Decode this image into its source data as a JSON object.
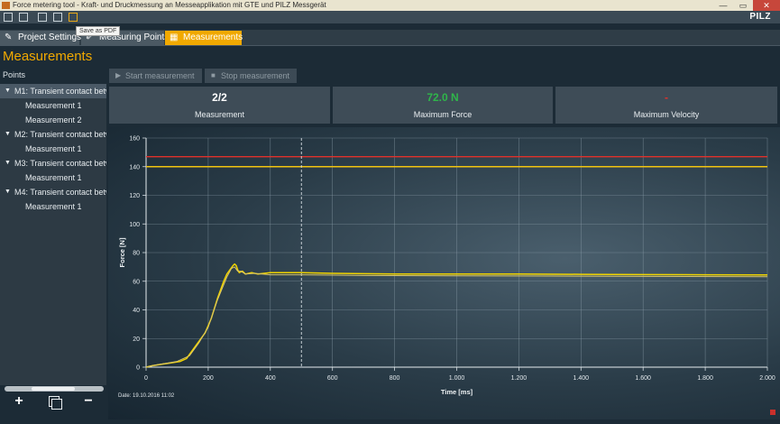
{
  "window": {
    "title": "Force metering tool - Kraft- und Druckmessung an Messeapplikation mit GTE und PILZ Messgerät",
    "brand": "PILZ",
    "minimize": "—",
    "maximize": "▭",
    "close": "✕"
  },
  "toolbar": {
    "tooltip": "Save as PDF"
  },
  "tabs": [
    {
      "label": "Project Settings",
      "icon": "✎"
    },
    {
      "label": "Measuring Points",
      "icon": "✐"
    },
    {
      "label": "Measurements",
      "icon": "▦"
    }
  ],
  "page": {
    "title": "Measurements",
    "points_label": "Points"
  },
  "tree": [
    {
      "label": "M1: Transient contact betw",
      "children": [
        "Measurement 1",
        "Measurement 2"
      ]
    },
    {
      "label": "M2: Transient contact betw",
      "children": [
        "Measurement 1"
      ]
    },
    {
      "label": "M3: Transient contact betw",
      "children": [
        "Measurement 1"
      ]
    },
    {
      "label": "M4: Transient contact betw",
      "children": [
        "Measurement 1"
      ]
    }
  ],
  "tree_buttons": {
    "add": "+",
    "remove": "−"
  },
  "controls": {
    "start": "Start measurement",
    "stop": "Stop measurement"
  },
  "cards": [
    {
      "value": "2/2",
      "label": "Measurement",
      "color": "#ffffff"
    },
    {
      "value": "72.0 N",
      "label": "Maximum Force",
      "color": "#2fb54a"
    },
    {
      "value": "-",
      "label": "Maximum Velocity",
      "color": "#e0312b"
    }
  ],
  "chart_footer": {
    "date": "Date: 19.10.2016 11:02"
  },
  "chart_data": {
    "type": "line",
    "xlabel": "Time [ms]",
    "ylabel": "Force [N]",
    "xlim": [
      0,
      2000
    ],
    "ylim": [
      0,
      160
    ],
    "xticks": [
      0,
      200,
      400,
      600,
      800,
      1000,
      1200,
      1400,
      1600,
      1800,
      2000
    ],
    "xtick_labels": [
      "0",
      "200",
      "400",
      "600",
      "800",
      "1.000",
      "1.200",
      "1.400",
      "1.600",
      "1.800",
      "2.000"
    ],
    "yticks": [
      0,
      20,
      40,
      60,
      80,
      100,
      120,
      140,
      160
    ],
    "grid": true,
    "thresholds": [
      {
        "value": 147,
        "color": "#e0312b"
      },
      {
        "value": 140,
        "color": "#f1c40f"
      }
    ],
    "marker_x": 500,
    "series": [
      {
        "color": "#f1d400",
        "x": [
          0,
          20,
          50,
          80,
          110,
          130,
          150,
          170,
          190,
          210,
          230,
          250,
          260,
          270,
          280,
          285,
          290,
          295,
          300,
          310,
          320,
          340,
          360,
          400,
          500,
          600,
          800,
          1000,
          1200,
          1400,
          1600,
          1800,
          2000
        ],
        "y": [
          0,
          1,
          2,
          3,
          4,
          6,
          12,
          18,
          24,
          34,
          48,
          60,
          65,
          68,
          71,
          72,
          71,
          68,
          66,
          67,
          65,
          66,
          65,
          66,
          66,
          65.5,
          65,
          65,
          65,
          64.8,
          64.6,
          64.5,
          64.4
        ]
      },
      {
        "color": "#d8c46a",
        "x": [
          0,
          30,
          60,
          100,
          140,
          170,
          200,
          230,
          260,
          275,
          285,
          295,
          305,
          320,
          350,
          400,
          500,
          700,
          1000,
          1300,
          1600,
          2000
        ],
        "y": [
          0,
          1.5,
          2.5,
          4,
          8,
          17,
          28,
          47,
          63,
          69,
          70,
          67,
          67,
          65,
          65.5,
          64.5,
          64.5,
          64,
          63.8,
          63.6,
          63.4,
          63.2
        ]
      }
    ]
  }
}
